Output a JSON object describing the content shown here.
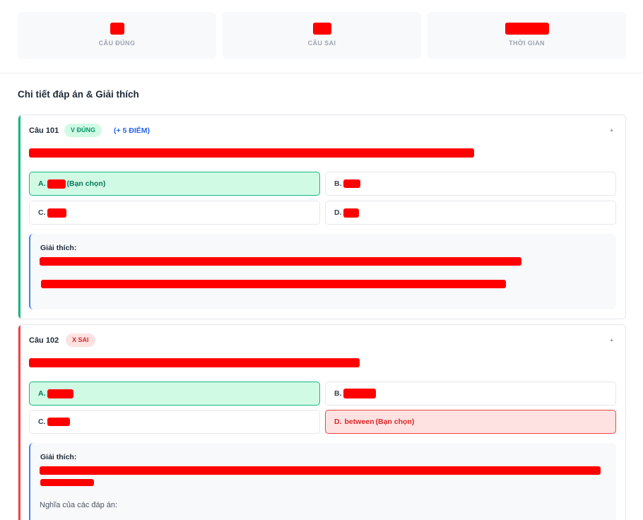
{
  "stats": [
    {
      "label": "CÂU ĐÚNG",
      "value": ""
    },
    {
      "label": "CÂU SAI",
      "value": ""
    },
    {
      "label": "THỜI GIAN",
      "value": ""
    }
  ],
  "section_title": "Chi tiết đáp án & Giải thích",
  "questions": [
    {
      "number": "Câu 101",
      "status": "V ĐÚNG",
      "points": "(+ 5 ĐIỂM)",
      "options": [
        {
          "letter": "A.",
          "text": "",
          "note": "(Bạn chọn)"
        },
        {
          "letter": "B.",
          "text": "",
          "note": ""
        },
        {
          "letter": "C.",
          "text": "",
          "note": ""
        },
        {
          "letter": "D.",
          "text": "",
          "note": ""
        }
      ],
      "explanation_title": "Giải thích:"
    },
    {
      "number": "Câu 102",
      "status": "X SAI",
      "options": [
        {
          "letter": "A.",
          "text": "",
          "note": ""
        },
        {
          "letter": "B.",
          "text": "",
          "note": ""
        },
        {
          "letter": "C.",
          "text": "",
          "note": ""
        },
        {
          "letter": "D.",
          "text": "between",
          "note": "(Bạn chọn)"
        }
      ],
      "explanation_title": "Giải thích:",
      "meanings_label": "Nghĩa của các đáp án:"
    }
  ],
  "colors": {
    "correct": "#10b981",
    "wrong": "#ef4444",
    "accent": "#3b82f6",
    "redaction": "#ff0000"
  },
  "icons": {
    "collapse": "chevron-up-icon"
  }
}
